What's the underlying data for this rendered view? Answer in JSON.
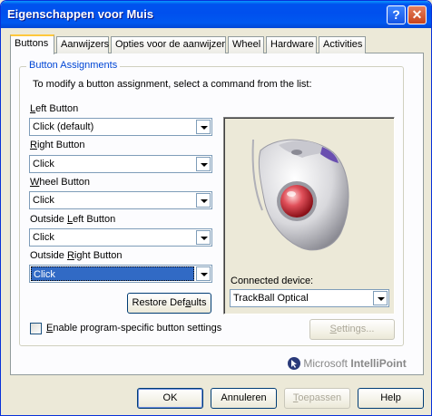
{
  "window": {
    "title": "Eigenschappen voor Muis"
  },
  "titlebar": {
    "help_label": "?",
    "close_label": "✕"
  },
  "tabs": [
    {
      "label": "Buttons"
    },
    {
      "label": "Aanwijzers"
    },
    {
      "label": "Opties voor de aanwijzer"
    },
    {
      "label": "Wheel"
    },
    {
      "label": "Hardware"
    },
    {
      "label": "Activities"
    }
  ],
  "group": {
    "title": "Button Assignments",
    "instruction": "To modify a button assignment, select a command from the list:"
  },
  "assignments": [
    {
      "label_pre": "",
      "label_key": "L",
      "label_post": "eft Button",
      "value": "Click (default)"
    },
    {
      "label_pre": "",
      "label_key": "R",
      "label_post": "ight Button",
      "value": "Click"
    },
    {
      "label_pre": "",
      "label_key": "W",
      "label_post": "heel Button",
      "value": "Click"
    },
    {
      "label_pre": "Outside ",
      "label_key": "L",
      "label_post": "eft Button",
      "value": "Click"
    },
    {
      "label_pre": "Outside ",
      "label_key": "R",
      "label_post": "ight Button",
      "value": "Click"
    }
  ],
  "restore_defaults": {
    "pre": "Restore Def",
    "key": "a",
    "post": "ults"
  },
  "connected_device": {
    "label": "Connected device:",
    "value": "TrackBall Optical"
  },
  "checkbox": {
    "pre": "",
    "key": "E",
    "post": "nable program-specific button settings",
    "checked": false
  },
  "settings_button": {
    "pre": "",
    "key": "S",
    "post": "ettings..."
  },
  "brand": {
    "maker": "Microsoft",
    "product": "IntelliPoint"
  },
  "footer": {
    "ok_label": "OK",
    "cancel_label": "Annuleren",
    "apply_pre": "",
    "apply_key": "T",
    "apply_post": "oepassen",
    "help_label": "Help"
  },
  "colors": {
    "titlebar": "#0053ee",
    "selection": "#316ac5",
    "group_title": "#0046d5"
  },
  "icons": {
    "pointer": "intellipoint-cursor-icon",
    "device": "trackball-mouse-icon"
  }
}
